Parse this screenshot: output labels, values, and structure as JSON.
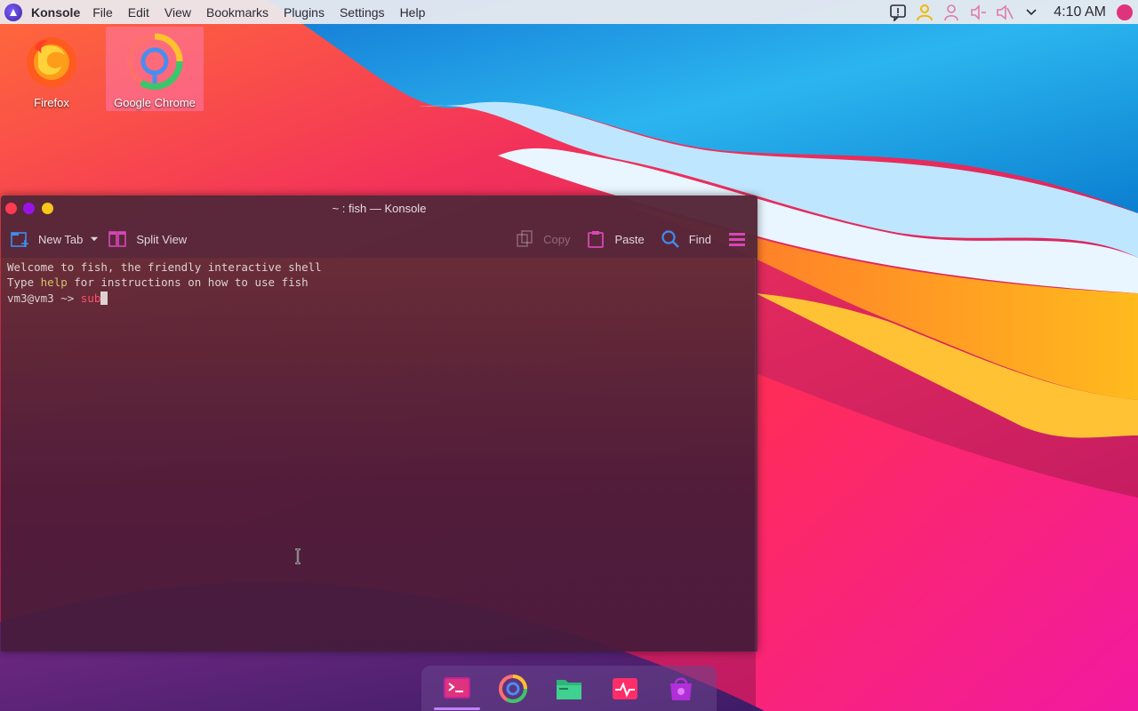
{
  "panel": {
    "app_name": "Konsole",
    "menu": [
      "File",
      "Edit",
      "View",
      "Bookmarks",
      "Plugins",
      "Settings",
      "Help"
    ],
    "clock": "4:10 AM"
  },
  "desktop": {
    "icons": [
      {
        "label": "Firefox",
        "icon": "firefox-icon"
      },
      {
        "label": "Google Chrome",
        "icon": "chrome-icon"
      }
    ]
  },
  "window": {
    "title": "~ : fish — Konsole",
    "toolbar": {
      "new_tab": "New Tab",
      "split_view": "Split View",
      "copy": "Copy",
      "paste": "Paste",
      "find": "Find"
    },
    "terminal": {
      "line1": "Welcome to fish, the friendly interactive shell",
      "line2_pre": "Type ",
      "line2_help": "help",
      "line2_post": " for instructions on how to use fish",
      "prompt": "vm3@vm3 ~> ",
      "typed": "sub"
    }
  },
  "dock": {
    "items": [
      "terminal-icon",
      "chrome-icon",
      "file-manager-icon",
      "system-monitor-icon",
      "app-store-icon"
    ]
  },
  "colors": {
    "accent": "#e0337d",
    "close": "#ff3b52",
    "minimize": "#9b12e8",
    "maximize": "#f8c51c"
  }
}
